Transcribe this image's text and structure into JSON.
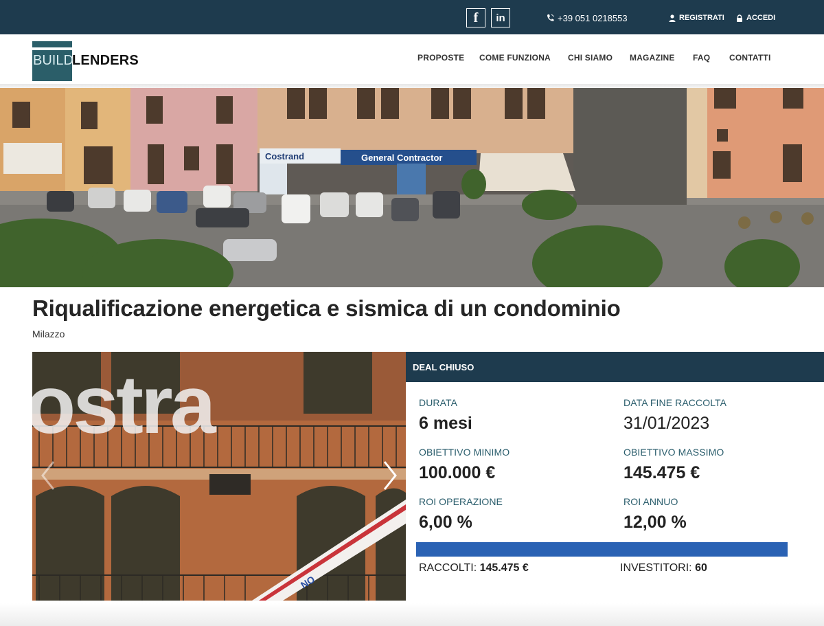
{
  "topbar": {
    "facebook_icon": "facebook-icon",
    "linkedin_icon": "linkedin-icon",
    "facebook_glyph": "f",
    "linkedin_glyph": "in",
    "phone": "+39 051 0218553",
    "register": "REGISTRATI",
    "login": "ACCEDI"
  },
  "logo": {
    "part1": "BUILD",
    "part2": "LENDERS"
  },
  "nav": [
    "PROPOSTE",
    "COME FUNZIONA",
    "CHI SIAMO",
    "MAGAZINE",
    "FAQ",
    "CONTATTI"
  ],
  "project": {
    "title": "Riqualificazione energetica e sismica di un condominio",
    "location": "Milazzo"
  },
  "hero": {
    "signs": [
      "Costrand",
      "General Contractor"
    ]
  },
  "gallery": {
    "overlay_text": "ostra",
    "crane_text": "NO"
  },
  "deal": {
    "status": "DEAL CHIUSO",
    "durata_label": "DURATA",
    "durata_value": "6 mesi",
    "data_fine_label": "DATA FINE RACCOLTA",
    "data_fine_value": "31/01/2023",
    "obiettivo_min_label": "OBIETTIVO MINIMO",
    "obiettivo_min_value": "100.000 €",
    "obiettivo_max_label": "OBIETTIVO MASSIMO",
    "obiettivo_max_value": "145.475 €",
    "roi_op_label": "ROI OPERAZIONE",
    "roi_op_value": "6,00 %",
    "roi_anno_label": "ROI ANNUO",
    "roi_anno_value": "12,00 %",
    "progress_fraction": 1.0,
    "raccolti_label": "RACCOLTI:",
    "raccolti_value": "145.475 €",
    "investitori_label": "INVESTITORI:",
    "investitori_value": "60"
  },
  "colors": {
    "topbar": "#1e3b4e",
    "accent_teal": "#2b5e69",
    "label_teal": "#2a5d6c",
    "progress": "#2a62b4"
  }
}
